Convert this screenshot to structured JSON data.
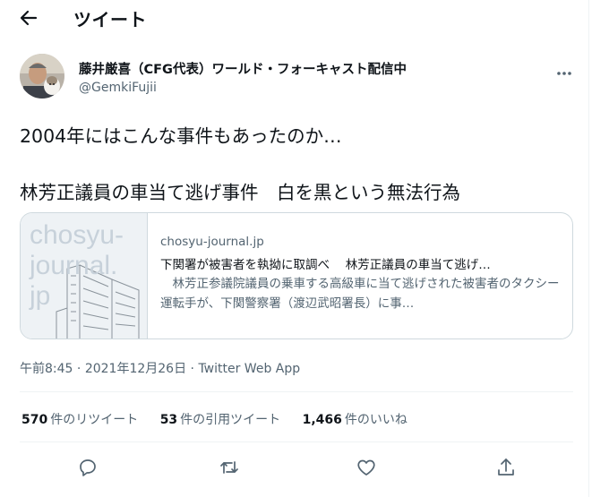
{
  "header": {
    "title": "ツイート"
  },
  "author": {
    "name": "藤井厳喜（CFG代表）ワールド・フォーキャスト配信中",
    "handle": "@GemkiFujii"
  },
  "tweet": {
    "line1": "2004年にはこんな事件もあったのか…",
    "line2": "林芳正議員の車当て逃げ事件　白を黒という無法行為"
  },
  "card": {
    "thumb_text": "chosyu-\njournal.\njp",
    "domain": "chosyu-journal.jp",
    "title": "下関署が被害者を執拗に取調べ　 林芳正議員の車当て逃げ…",
    "description": "　林芳正参議院議員の乗車する高級車に当て逃げされた被害者のタクシー運転手が、下関警察署（渡辺武昭署長）に事…"
  },
  "meta": {
    "time": "午前8:45",
    "date": "2021年12月26日",
    "source": "Twitter Web App",
    "separator": "·"
  },
  "stats": {
    "retweets": {
      "count": "570",
      "label": "件のリツイート"
    },
    "quotes": {
      "count": "53",
      "label": "件の引用ツイート"
    },
    "likes": {
      "count": "1,466",
      "label": "件のいいね"
    }
  },
  "icons": {
    "back": "arrow-left-icon",
    "more": "more-icon",
    "reply": "reply-icon",
    "retweet": "retweet-icon",
    "like": "heart-icon",
    "share": "share-icon"
  },
  "colors": {
    "text": "#0f1419",
    "secondary": "#536471",
    "border": "#cfd9de",
    "divider": "#eff3f4"
  }
}
